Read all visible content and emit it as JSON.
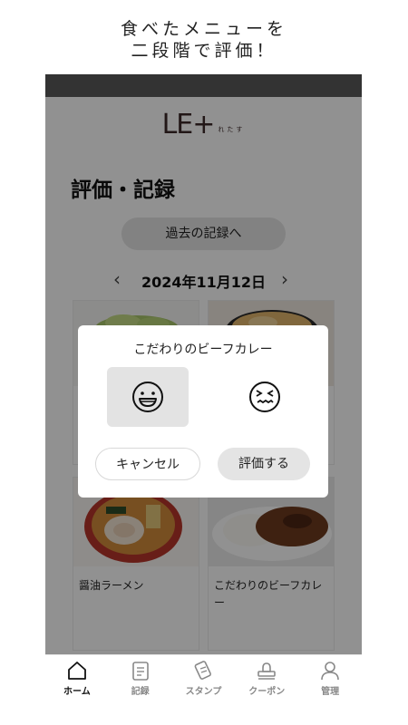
{
  "promo": {
    "line1": "食べたメニューを",
    "line2": "二段階で評価！"
  },
  "logo": {
    "mark": "LE+",
    "sub": "れたす"
  },
  "page": {
    "title": "評価・記録",
    "past_button": "過去の記録へ"
  },
  "date_nav": {
    "date": "2024年11月12日",
    "prev": "‹",
    "next": "›"
  },
  "cards": [
    {
      "name": ""
    },
    {
      "name": ""
    },
    {
      "name": "醤油ラーメン"
    },
    {
      "name": "こだわりのビーフカレー"
    }
  ],
  "dialog": {
    "title": "こだわりのビーフカレー",
    "good_icon": "smile-icon",
    "bad_icon": "frown-icon",
    "cancel_label": "キャンセル",
    "submit_label": "評価する"
  },
  "tabs": [
    {
      "label": "ホーム",
      "icon": "home-icon",
      "active": true
    },
    {
      "label": "記録",
      "icon": "record-icon",
      "active": false
    },
    {
      "label": "スタンプ",
      "icon": "stamp-icon",
      "active": false
    },
    {
      "label": "クーポン",
      "icon": "coupon-icon",
      "active": false
    },
    {
      "label": "管理",
      "icon": "person-icon",
      "active": false
    }
  ]
}
